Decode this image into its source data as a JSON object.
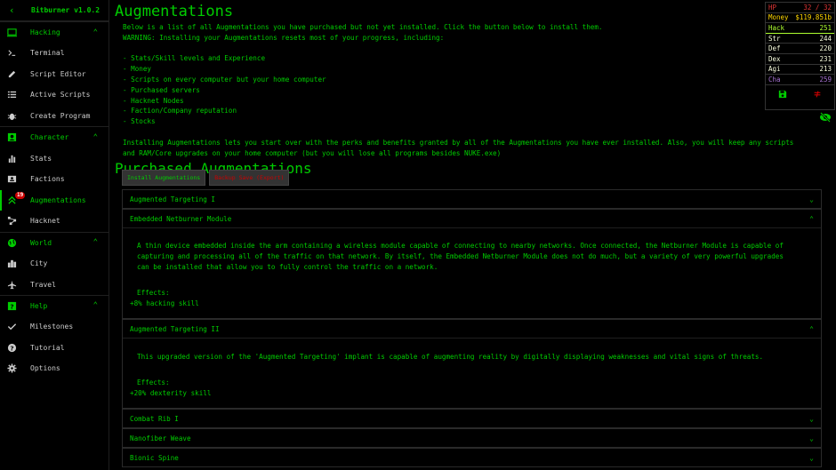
{
  "sidebar": {
    "version": "Bitburner v1.0.2",
    "categories": [
      {
        "label": "Hacking",
        "items": [
          {
            "label": "Terminal",
            "icon": "terminal-icon"
          },
          {
            "label": "Script Editor",
            "icon": "pencil-icon"
          },
          {
            "label": "Active Scripts",
            "icon": "list-icon"
          },
          {
            "label": "Create Program",
            "icon": "bug-icon"
          }
        ]
      },
      {
        "label": "Character",
        "items": [
          {
            "label": "Stats",
            "icon": "bar-chart-icon"
          },
          {
            "label": "Factions",
            "icon": "contacts-icon"
          },
          {
            "label": "Augmentations",
            "icon": "double-chevron-up-icon",
            "badge": "19"
          },
          {
            "label": "Hacknet",
            "icon": "hub-icon"
          }
        ]
      },
      {
        "label": "World",
        "items": [
          {
            "label": "City",
            "icon": "city-icon"
          },
          {
            "label": "Travel",
            "icon": "airplane-icon"
          }
        ]
      },
      {
        "label": "Help",
        "items": [
          {
            "label": "Milestones",
            "icon": "check-icon"
          },
          {
            "label": "Tutorial",
            "icon": "help-circle-icon"
          },
          {
            "label": "Options",
            "icon": "gear-icon"
          }
        ]
      }
    ]
  },
  "page": {
    "title": "Augmentations",
    "intro": "Below is a list of all Augmentations you have purchased but not yet installed. Click the button below to install them.\nWARNING: Installing your Augmentations resets most of your progress, including:\n\n- Stats/Skill levels and Experience\n- Money\n- Scripts on every computer but your home computer\n- Purchased servers\n- Hacknet Nodes\n- Faction/Company reputation\n- Stocks\n\nInstalling Augmentations lets you start over with the perks and benefits granted by all of the Augmentations you have ever installed. Also, you will keep any scripts\nand RAM/Core upgrades on your home computer (but you will lose all programs besides NUKE.exe)",
    "purchased_heading": "Purchased Augmentations",
    "install_button": "Install Augmentations",
    "backup_button": "Backup Save (Export)",
    "augmentations": [
      {
        "name": "Augmented Targeting I",
        "expanded": false
      },
      {
        "name": "Embedded Netburner Module",
        "expanded": true,
        "description": "A thin device embedded inside the arm containing a wireless module capable of connecting to nearby networks. Once connected, the Netburner Module is capable of\ncapturing and processing all of the traffic on that network. By itself, the Embedded Netburner Module does not do much, but a variety of very powerful upgrades\ncan be installed that allow you to fully control the traffic on a network.",
        "effects_label": "Effects:",
        "effect": "+8% hacking skill"
      },
      {
        "name": "Augmented Targeting II",
        "expanded": true,
        "description": "This upgraded version of the 'Augmented Targeting' implant is capable of augmenting reality by digitally displaying weaknesses and vital signs of threats.",
        "effects_label": "Effects:",
        "effect": "+20% dexterity skill"
      },
      {
        "name": "Combat Rib I",
        "expanded": false
      },
      {
        "name": "Nanofiber Weave",
        "expanded": false
      },
      {
        "name": "Bionic Spine",
        "expanded": false
      }
    ]
  },
  "overview": {
    "hp_label": "HP",
    "hp_value": "32 / 32",
    "money_label": "Money",
    "money_value": "$119.851b",
    "hack_label": "Hack",
    "hack_value": "251",
    "str_label": "Str",
    "str_value": "244",
    "def_label": "Def",
    "def_value": "220",
    "dex_label": "Dex",
    "dex_value": "231",
    "agi_label": "Agi",
    "agi_value": "213",
    "cha_label": "Cha",
    "cha_value": "259",
    "colors": {
      "hp": "#dd3434",
      "money": "#ffd700",
      "hack": "#adff2f",
      "combat": "#faffdf",
      "cha": "#a671d1"
    }
  },
  "colors": {
    "primary": "#00cc00",
    "error": "#cc0000",
    "background": "#000000"
  }
}
